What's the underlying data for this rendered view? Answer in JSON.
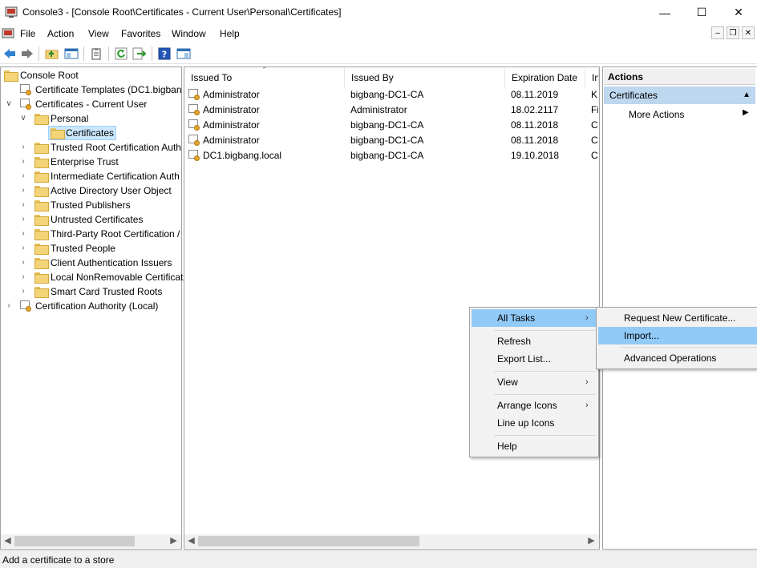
{
  "window": {
    "title": "Console3 - [Console Root\\Certificates - Current User\\Personal\\Certificates]",
    "minimize": "—",
    "maximize": "☐",
    "close": "✕"
  },
  "menubar": {
    "items": [
      "File",
      "Action",
      "View",
      "Favorites",
      "Window",
      "Help"
    ],
    "mdi_controls": [
      "–",
      "❐",
      "✕"
    ]
  },
  "toolbar": {
    "icons": [
      "back-arrow-icon",
      "forward-arrow-icon",
      "up-folder-icon",
      "show-hide-tree-icon",
      "properties-icon",
      "refresh-icon",
      "export-list-icon",
      "help-icon",
      "show-hide-action-pane-icon"
    ]
  },
  "tree": {
    "root": "Console Root",
    "templates": "Certificate Templates (DC1.bigban",
    "current_user": "Certificates - Current User",
    "personal": "Personal",
    "certificates": "Certificates",
    "stores": [
      "Trusted Root Certification Auth",
      "Enterprise Trust",
      "Intermediate Certification Auth",
      "Active Directory User Object",
      "Trusted Publishers",
      "Untrusted Certificates",
      "Third-Party Root Certification /",
      "Trusted People",
      "Client Authentication Issuers",
      "Local NonRemovable Certificat",
      "Smart Card Trusted Roots"
    ],
    "ca": "Certification Authority (Local)"
  },
  "list": {
    "columns": [
      "Issued To",
      "Issued By",
      "Expiration Date",
      "In"
    ],
    "rows": [
      {
        "issued_to": "Administrator",
        "issued_by": "bigbang-DC1-CA",
        "expiration": "08.11.2019",
        "intended": "K"
      },
      {
        "issued_to": "Administrator",
        "issued_by": "Administrator",
        "expiration": "18.02.2117",
        "intended": "Fi"
      },
      {
        "issued_to": "Administrator",
        "issued_by": "bigbang-DC1-CA",
        "expiration": "08.11.2018",
        "intended": "C"
      },
      {
        "issued_to": "Administrator",
        "issued_by": "bigbang-DC1-CA",
        "expiration": "08.11.2018",
        "intended": "C"
      },
      {
        "issued_to": "DC1.bigbang.local",
        "issued_by": "bigbang-DC1-CA",
        "expiration": "19.10.2018",
        "intended": "C"
      }
    ]
  },
  "actions": {
    "header": "Actions",
    "section": "Certificates",
    "more_actions": "More Actions"
  },
  "context_menu": {
    "all_tasks": "All Tasks",
    "refresh": "Refresh",
    "export_list": "Export List...",
    "view": "View",
    "arrange_icons": "Arrange Icons",
    "line_up_icons": "Line up Icons",
    "help": "Help"
  },
  "submenu": {
    "request_new": "Request New Certificate...",
    "import": "Import...",
    "advanced": "Advanced Operations"
  },
  "status": "Add a certificate to a store",
  "colors": {
    "highlight": "#91c9f7",
    "action_section": "#bdd7ee",
    "selected": "#cce8ff"
  }
}
